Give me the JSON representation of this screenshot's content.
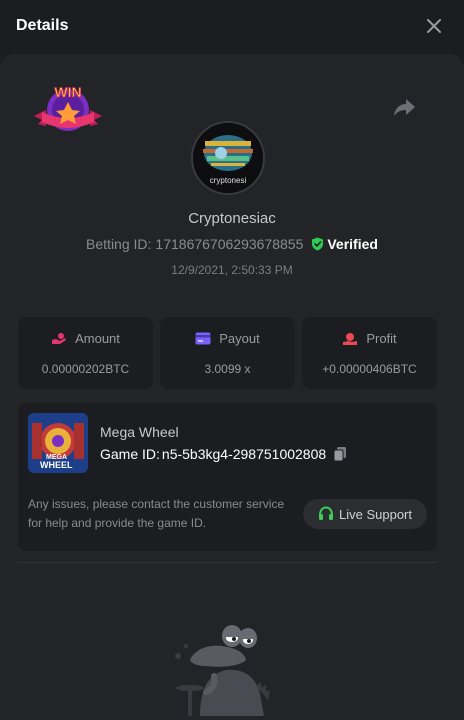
{
  "header": {
    "title": "Details"
  },
  "badge": {
    "text": "WIN"
  },
  "player": {
    "username": "Cryptonesiac",
    "avatar_text": "cryptonesi",
    "betting_label": "Betting ID:",
    "betting_id": "1718676706293678855",
    "verified_label": "Verified",
    "date": "12/9/2021, 2:50:33 PM"
  },
  "stats": {
    "amount": {
      "label": "Amount",
      "value": "0.00000202BTC"
    },
    "payout": {
      "label": "Payout",
      "value": "3.0099 x"
    },
    "profit": {
      "label": "Profit",
      "value": "+0.00000406BTC"
    }
  },
  "game": {
    "name": "Mega Wheel",
    "thumb_text_1": "MEGA",
    "thumb_text_2": "WHEEL",
    "id_label": "Game ID:",
    "id_value": "n5-5b3kg4-298751002808",
    "contact_text": "Any issues, please contact the customer service for help and provide the game ID.",
    "support_label": "Live Support"
  },
  "colors": {
    "accent_pink": "#e8356e",
    "accent_purple": "#7b61ff",
    "accent_red": "#e94a53",
    "verified_green": "#2ecc52",
    "support_green": "#3ccf56"
  }
}
